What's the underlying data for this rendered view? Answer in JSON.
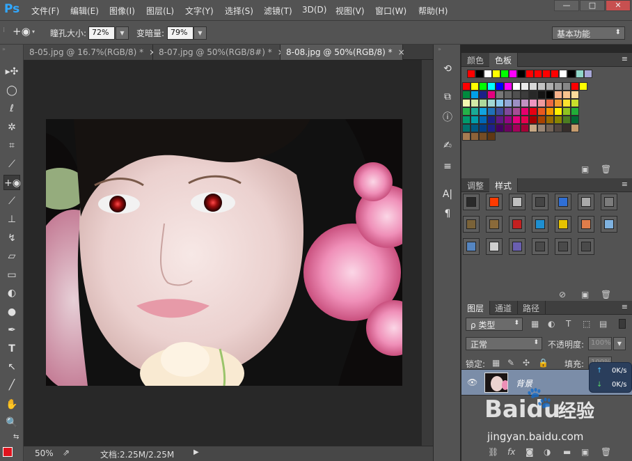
{
  "app": {
    "logo": "Ps"
  },
  "menu": [
    "文件(F)",
    "编辑(E)",
    "图像(I)",
    "图层(L)",
    "文字(Y)",
    "选择(S)",
    "滤镜(T)",
    "3D(D)",
    "视图(V)",
    "窗口(W)",
    "帮助(H)"
  ],
  "window_controls": {
    "minimize": "—",
    "restore": "□",
    "close": "✕"
  },
  "options": {
    "tool_icon": "red-eye-tool-icon",
    "pupil_label": "瞳孔大小:",
    "pupil_value": "72%",
    "darken_label": "变暗量:",
    "darken_value": "79%",
    "workspace": "基本功能"
  },
  "tabs": [
    {
      "label": "8-05.jpg @ 16.7%(RGB/8) *",
      "close": "×"
    },
    {
      "label": "8-07.jpg @ 50%(RGB/8#) *",
      "close": "×"
    },
    {
      "label": "8-08.jpg @ 50%(RGB/8) *",
      "close": "×"
    }
  ],
  "status": {
    "zoom": "50%",
    "doc": "文档:2.25M/2.25M",
    "arrow": "▶"
  },
  "color_panel": {
    "tabs": [
      "颜色",
      "色板"
    ],
    "active_tab": "色板",
    "top_row": [
      "#ff0000",
      "#000000",
      "#ffffff",
      "#ffff00",
      "#00ff00",
      "#ff00ff",
      "#000000",
      "#ff0000",
      "#ff0000",
      "#ff0000",
      "#ff0000",
      "#ffffff",
      "#000000",
      "#8fd6c9",
      "#a7a7d8"
    ],
    "rows": [
      [
        "#ff0000",
        "#ffff00",
        "#00ff00",
        "#00ffff",
        "#0000ff",
        "#ff00ff",
        "#ffffff",
        "#ebebeb",
        "#d7d7d7",
        "#c3c3c3",
        "#afafaf",
        "#9b9b9b",
        "#878787",
        "#ff0000",
        "#ffff00"
      ],
      [
        "#008a3e",
        "#009fe8",
        "#1d2087",
        "#e4007f",
        "#787878",
        "#646464",
        "#505050",
        "#3c3c3c",
        "#282828",
        "#141414",
        "#000000",
        "#f6b18b",
        "#f8c38e",
        "#fcdc9b"
      ],
      [
        "#f4f9b0",
        "#d2e9a6",
        "#aed89b",
        "#a1d7d4",
        "#89c9ef",
        "#92a7d6",
        "#9c8fc4",
        "#c192c2",
        "#ef96c0",
        "#f09a9d",
        "#ec6941",
        "#f29b30",
        "#fae22f",
        "#c6de2c"
      ],
      [
        "#25b249",
        "#1aaa96",
        "#12a3e0",
        "#1f70b8",
        "#3f4a9c",
        "#7f4a9b",
        "#a54d95",
        "#e5006e",
        "#e60012",
        "#e9591f",
        "#f39800",
        "#fff000",
        "#8fc31f",
        "#22ac38"
      ],
      [
        "#009b6b",
        "#009ea9",
        "#0068b7",
        "#1d2088",
        "#601986",
        "#920783",
        "#e4007f",
        "#e5004f",
        "#a40000",
        "#a84200",
        "#996c00",
        "#8a8600",
        "#4c7d21",
        "#006934"
      ],
      [
        "#00736d",
        "#005982",
        "#003f88",
        "#1d2088",
        "#440062",
        "#6a005f",
        "#a4005b",
        "#a40035",
        "#c7a885",
        "#998675",
        "#736357",
        "#534741",
        "#362e2b",
        "#c69c6d"
      ],
      [
        "#a67c52",
        "#8c6239",
        "#754c24",
        "#603813"
      ]
    ]
  },
  "styles_panel": {
    "tabs": [
      "调整",
      "样式"
    ],
    "active_tab": "样式",
    "cells": [
      "#2a2a2a",
      "#ff3b00",
      "#c0c0c0",
      "#454545",
      "#2f6fd6",
      "#aaaaaa",
      "#7c7c7c",
      "#7a6238",
      "#8a6a3a",
      "#c42020",
      "#1e8fd0",
      "#e6c200",
      "#e07d4a",
      "#7fb2e0",
      "#5585c0",
      "#cfcfcf",
      "#6a5fb0",
      "#4a4a4a",
      "#4a4a4a",
      "#4a4a4a"
    ]
  },
  "layers_panel": {
    "tabs": [
      "图层",
      "通道",
      "路径"
    ],
    "active_tab": "图层",
    "filter": "ρ 类型",
    "blend_mode": "正常",
    "opacity_label": "不透明度:",
    "opacity_value": "100%",
    "lock_label": "锁定:",
    "fill_label": "填充:",
    "fill_value": "100%",
    "layer_name": "背景"
  },
  "net_widget": {
    "upload": "0K/s",
    "download": "0K/s"
  },
  "watermark": {
    "brand": "Baidu",
    "paw": "🐾",
    "cn": "经验",
    "url": "jingyan.baidu.com"
  }
}
